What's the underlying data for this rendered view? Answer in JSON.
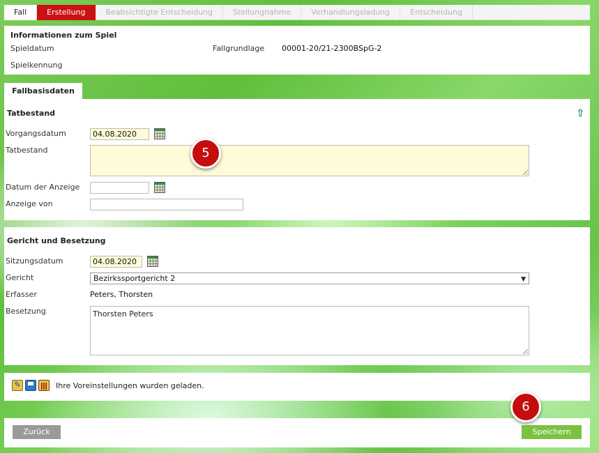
{
  "tabs": [
    {
      "label": "Fall",
      "state": "normal"
    },
    {
      "label": "Erstellung",
      "state": "active"
    },
    {
      "label": "Beabsichtigte Entscheidung",
      "state": "disabled"
    },
    {
      "label": "Stellungnahme",
      "state": "disabled"
    },
    {
      "label": "Verhandlungsladung",
      "state": "disabled"
    },
    {
      "label": "Entscheidung",
      "state": "disabled"
    }
  ],
  "info": {
    "title": "Informationen zum Spiel",
    "spieldatum_label": "Spieldatum",
    "fallgrundlage_label": "Fallgrundlage",
    "fallgrundlage_value": "00001-20/21-2300BSpG-2",
    "spielkennung_label": "Spielkennung"
  },
  "subtab": {
    "label": "Fallbasisdaten"
  },
  "tatbestand": {
    "title": "Tatbestand",
    "vorgangsdatum_label": "Vorgangsdatum",
    "vorgangsdatum_value": "04.08.2020",
    "tatbestand_label": "Tatbestand",
    "tatbestand_value": "",
    "datum_anzeige_label": "Datum der Anzeige",
    "datum_anzeige_value": "",
    "anzeige_von_label": "Anzeige von",
    "anzeige_von_value": ""
  },
  "gericht": {
    "title": "Gericht und Besetzung",
    "sitzungsdatum_label": "Sitzungsdatum",
    "sitzungsdatum_value": "04.08.2020",
    "gericht_label": "Gericht",
    "gericht_selected": "Bezirkssportgericht 2",
    "erfasser_label": "Erfasser",
    "erfasser_value": "Peters, Thorsten",
    "besetzung_label": "Besetzung",
    "besetzung_value": "Thorsten Peters"
  },
  "status": {
    "message": "Ihre Voreinstellungen wurden geladen."
  },
  "footer": {
    "back_label": "Zurück",
    "save_label": "Speichern"
  },
  "badges": {
    "step5": "5",
    "step6": "6"
  },
  "colors": {
    "active_tab": "#cc1111",
    "save_button": "#7cc241",
    "back_button": "#9a9a9a",
    "required_field": "#fffbd9",
    "badge": "#c40d0d"
  }
}
